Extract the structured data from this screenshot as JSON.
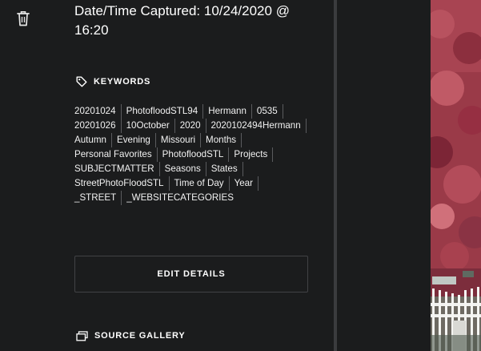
{
  "rail": {
    "delete_icon": "trash-icon"
  },
  "details": {
    "captured_label": "Date/Time Captured: 10/24/2020 @ 16:20"
  },
  "keywords": {
    "heading": "KEYWORDS",
    "icon": "tag-icon",
    "items": [
      "20201024",
      "PhotofloodSTL94",
      "Hermann",
      "0535",
      "20201026",
      "10October",
      "2020",
      "2020102494Hermann",
      "Autumn",
      "Evening",
      "Missouri",
      "Months",
      "Personal Favorites",
      "PhotofloodSTL",
      "Projects",
      "SUBJECTMATTER",
      "Seasons",
      "States",
      "StreetPhotoFloodSTL",
      "Time of Day",
      "Year",
      "_STREET",
      "_WEBSITECATEGORIES"
    ]
  },
  "actions": {
    "edit_label": "EDIT DETAILS"
  },
  "source_gallery": {
    "heading": "SOURCE GALLERY",
    "icon": "gallery-icon"
  },
  "colors": {
    "background": "#1b1c1d",
    "divider": "#3b3c3e",
    "text": "#ffffff",
    "button_border": "#414245"
  }
}
